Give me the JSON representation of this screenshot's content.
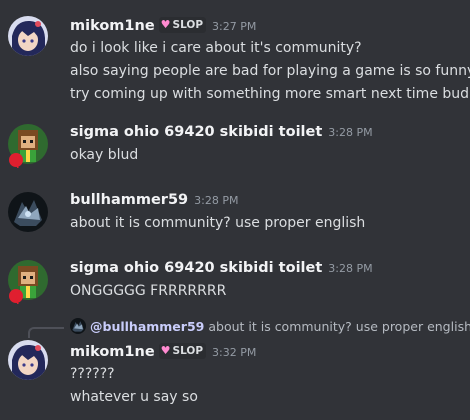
{
  "messages": [
    {
      "username": "mikom1ne",
      "tag": "SLOP",
      "tag_icon": "bunny-icon",
      "timestamp": "3:27 PM",
      "lines": [
        "do i look like i care about it's community?",
        "also saying people are bad for playing a game is so funny",
        "try coming up with something more smart next time bud"
      ]
    },
    {
      "username": "sigma ohio 69420 skibidi toilet",
      "timestamp": "3:28 PM",
      "lines": [
        "okay blud"
      ]
    },
    {
      "username": "bullhammer59",
      "timestamp": "3:28 PM",
      "lines": [
        "about it is community? use proper english"
      ]
    },
    {
      "username": "sigma ohio 69420 skibidi toilet",
      "timestamp": "3:28 PM",
      "lines": [
        "ONGGGGG FRRRRRRR"
      ]
    },
    {
      "reply": {
        "mention": "@bullhammer59",
        "text": "about it is community? use proper english"
      },
      "username": "mikom1ne",
      "tag": "SLOP",
      "tag_icon": "bunny-icon",
      "timestamp": "3:32 PM",
      "lines": [
        "??????",
        "whatever u say so"
      ]
    }
  ],
  "colors": {
    "background": "#313338",
    "username": "#f2f3f5",
    "text": "#dbdee1",
    "timestamp": "#949ba4",
    "mention": "#c9cdfb"
  }
}
